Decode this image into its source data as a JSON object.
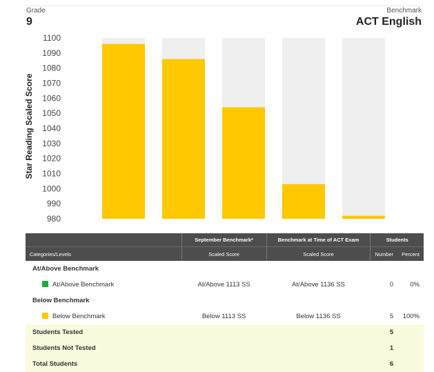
{
  "header": {
    "grade_caption": "Grade",
    "grade_value": "9",
    "benchmark_caption": "Benchmark",
    "benchmark_value": "ACT English"
  },
  "chart_data": {
    "type": "bar",
    "ylabel": "Star Reading Scaled Score",
    "ylim": [
      980,
      1100
    ],
    "ticks": [
      1100,
      1090,
      1080,
      1070,
      1060,
      1050,
      1040,
      1030,
      1020,
      1010,
      1000,
      990,
      980
    ],
    "values": [
      1096,
      1086,
      1054,
      1003,
      982
    ],
    "colors": {
      "bar": "#ffc800",
      "background": "#efefef"
    }
  },
  "table": {
    "col_categories": "Categories/Levels",
    "col_sept": "September Benchmark*",
    "col_act": "Benchmark at Time of ACT Exam",
    "col_students": "Students",
    "sub_sept": "Scaled Score",
    "sub_act": "Scaled Score",
    "sub_number": "Number",
    "sub_percent": "Percent",
    "groups": [
      {
        "title": "At/Above Benchmark",
        "label": "At/Above Benchmark",
        "color": "#1aab3a",
        "sept": "At/Above 1113 SS",
        "act": "At/Above 1136 SS",
        "number": "0",
        "percent": "0%"
      },
      {
        "title": "Below Benchmark",
        "label": "Below Benchmark",
        "color": "#ffc800",
        "sept": "Below 1113 SS",
        "act": "Below 1136 SS",
        "number": "5",
        "percent": "100%"
      }
    ],
    "summary": [
      {
        "label": "Students Tested",
        "number": "5"
      },
      {
        "label": "Students Not Tested",
        "number": "1"
      },
      {
        "label": "Total Students",
        "number": "6"
      }
    ]
  }
}
